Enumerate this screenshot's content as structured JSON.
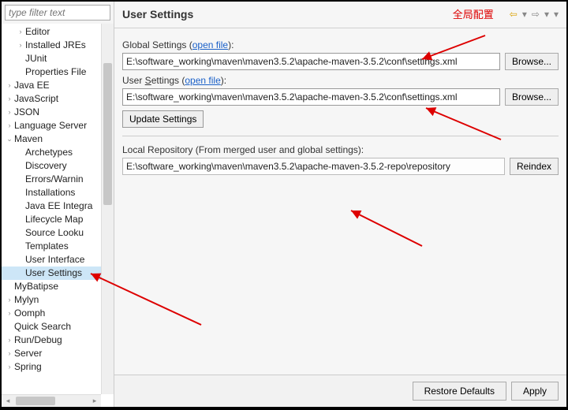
{
  "sidebar": {
    "filter_placeholder": "type filter text",
    "items": [
      {
        "label": "Editor",
        "level": 1,
        "exp": "right"
      },
      {
        "label": "Installed JREs",
        "level": 1,
        "exp": "right"
      },
      {
        "label": "JUnit",
        "level": 1,
        "exp": ""
      },
      {
        "label": "Properties File",
        "level": 1,
        "exp": ""
      },
      {
        "label": "Java EE",
        "level": 0,
        "exp": "right"
      },
      {
        "label": "JavaScript",
        "level": 0,
        "exp": "right"
      },
      {
        "label": "JSON",
        "level": 0,
        "exp": "right"
      },
      {
        "label": "Language Server",
        "level": 0,
        "exp": "right"
      },
      {
        "label": "Maven",
        "level": 0,
        "exp": "down"
      },
      {
        "label": "Archetypes",
        "level": 1,
        "exp": ""
      },
      {
        "label": "Discovery",
        "level": 1,
        "exp": ""
      },
      {
        "label": "Errors/Warnin",
        "level": 1,
        "exp": ""
      },
      {
        "label": "Installations",
        "level": 1,
        "exp": ""
      },
      {
        "label": "Java EE Integra",
        "level": 1,
        "exp": ""
      },
      {
        "label": "Lifecycle Map",
        "level": 1,
        "exp": ""
      },
      {
        "label": "Source Looku",
        "level": 1,
        "exp": ""
      },
      {
        "label": "Templates",
        "level": 1,
        "exp": ""
      },
      {
        "label": "User Interface",
        "level": 1,
        "exp": ""
      },
      {
        "label": "User Settings",
        "level": 1,
        "exp": "",
        "selected": true
      },
      {
        "label": "MyBatipse",
        "level": 0,
        "exp": ""
      },
      {
        "label": "Mylyn",
        "level": 0,
        "exp": "right"
      },
      {
        "label": "Oomph",
        "level": 0,
        "exp": "right"
      },
      {
        "label": "Quick Search",
        "level": 0,
        "exp": ""
      },
      {
        "label": "Run/Debug",
        "level": 0,
        "exp": "right"
      },
      {
        "label": "Server",
        "level": 0,
        "exp": "right"
      },
      {
        "label": "Spring",
        "level": 0,
        "exp": "right"
      }
    ]
  },
  "header": {
    "title": "User Settings",
    "annotation": "全局配置"
  },
  "settings": {
    "global_label_pre": "Global Settings (",
    "global_link": "open file",
    "global_label_post": "):",
    "global_path": "E:\\software_working\\maven\\maven3.5.2\\apache-maven-3.5.2\\conf\\settings.xml",
    "user_label_pre": "User ",
    "user_label_underline": "S",
    "user_label_mid": "ettings (",
    "user_link": "open file",
    "user_label_post": "):",
    "user_path": "E:\\software_working\\maven\\maven3.5.2\\apache-maven-3.5.2\\conf\\settings.xml",
    "update_btn": "Update Settings",
    "repo_label": "Local Repository (From merged user and global settings):",
    "repo_path": "E:\\software_working\\maven\\maven3.5.2\\apache-maven-3.5.2-repo\\repository",
    "browse_btn": "Browse...",
    "reindex_btn": "Reindex"
  },
  "footer": {
    "restore": "Restore Defaults",
    "apply": "Apply"
  }
}
